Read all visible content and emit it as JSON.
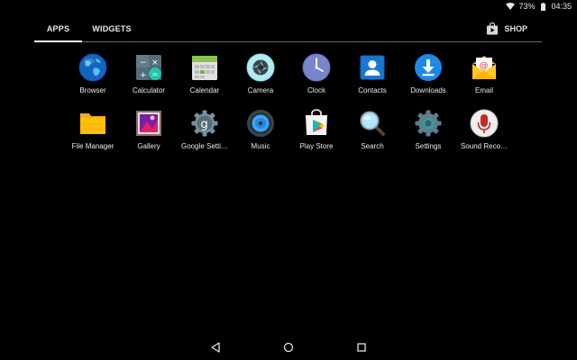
{
  "status_bar": {
    "battery": "73%",
    "time": "04:35"
  },
  "tabs": {
    "apps": "APPS",
    "widgets": "WIDGETS",
    "shop": "SHOP"
  },
  "apps": [
    {
      "label": "Browser",
      "icon": "browser-icon"
    },
    {
      "label": "Calculator",
      "icon": "calculator-icon"
    },
    {
      "label": "Calendar",
      "icon": "calendar-icon"
    },
    {
      "label": "Camera",
      "icon": "camera-icon"
    },
    {
      "label": "Clock",
      "icon": "clock-icon"
    },
    {
      "label": "Contacts",
      "icon": "contacts-icon"
    },
    {
      "label": "Downloads",
      "icon": "downloads-icon"
    },
    {
      "label": "Email",
      "icon": "email-icon"
    },
    {
      "label": "File Manager",
      "icon": "file-manager-icon"
    },
    {
      "label": "Gallery",
      "icon": "gallery-icon"
    },
    {
      "label": "Google Setti…",
      "icon": "google-settings-icon"
    },
    {
      "label": "Music",
      "icon": "music-icon"
    },
    {
      "label": "Play Store",
      "icon": "play-store-icon"
    },
    {
      "label": "Search",
      "icon": "search-icon"
    },
    {
      "label": "Settings",
      "icon": "settings-icon"
    },
    {
      "label": "Sound Reco…",
      "icon": "sound-recorder-icon"
    }
  ],
  "colors": {
    "background": "#000000",
    "downloads": "#1e88e5",
    "contacts": "#1976d2",
    "clock": "#7986cb",
    "recorder": "#c62828"
  }
}
